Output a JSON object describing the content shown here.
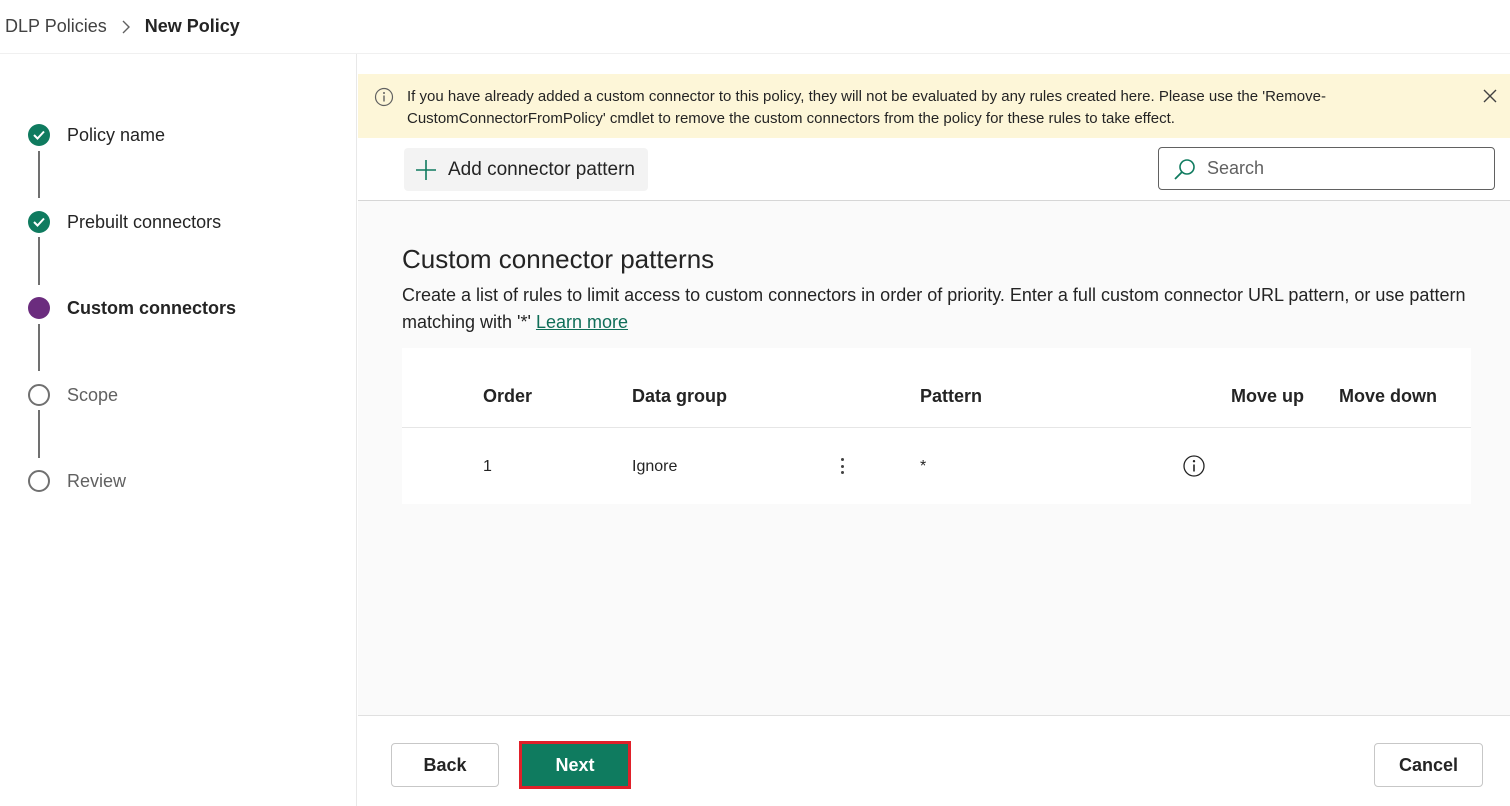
{
  "breadcrumb": {
    "parent": "DLP Policies",
    "current": "New Policy"
  },
  "steps": [
    {
      "label": "Policy name",
      "state": "done"
    },
    {
      "label": "Prebuilt connectors",
      "state": "done"
    },
    {
      "label": "Custom connectors",
      "state": "current"
    },
    {
      "label": "Scope",
      "state": "todo"
    },
    {
      "label": "Review",
      "state": "todo"
    }
  ],
  "banner": {
    "message": "If you have already added a custom connector to this policy, they will not be evaluated by any rules created here. Please use the 'Remove-CustomConnectorFromPolicy' cmdlet to remove the custom connectors from the policy for these rules to take effect."
  },
  "toolbar": {
    "add_label": "Add connector pattern",
    "search_placeholder": "Search"
  },
  "section": {
    "title": "Custom connector patterns",
    "description": "Create a list of rules to limit access to custom connectors in order of priority. Enter a full custom connector URL pattern, or use pattern matching with '*'",
    "learn_more": "Learn more"
  },
  "table": {
    "columns": [
      "Order",
      "Data group",
      "Pattern",
      "Move up",
      "Move down"
    ],
    "rows": [
      {
        "order": "1",
        "data_group": "Ignore",
        "pattern": "*"
      }
    ]
  },
  "footer": {
    "back": "Back",
    "next": "Next",
    "cancel": "Cancel"
  },
  "colors": {
    "accent": "#0f7b5f",
    "current_step": "#6b2c7e",
    "banner_bg": "#fdf6d8",
    "highlight": "#e0202a"
  }
}
